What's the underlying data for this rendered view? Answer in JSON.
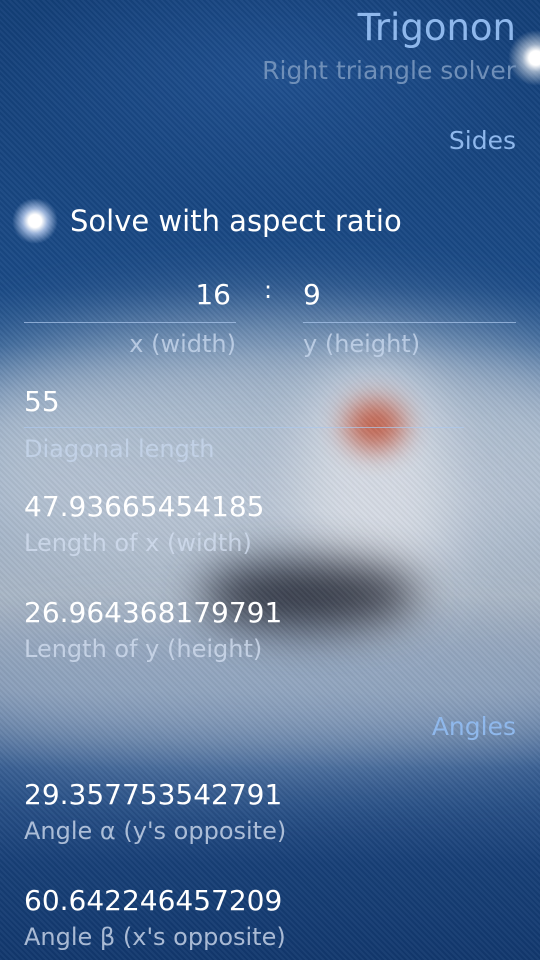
{
  "header": {
    "title": "Trigonon",
    "subtitle": "Right triangle solver"
  },
  "sections": {
    "sides": "Sides",
    "angles": "Angles"
  },
  "aspect_switch": {
    "label": "Solve with aspect ratio",
    "checked": true
  },
  "ratio": {
    "x_value": "16",
    "x_label": "x (width)",
    "separator": ":",
    "y_value": "9",
    "y_label": "y (height)"
  },
  "diagonal": {
    "value": "55",
    "label": "Diagonal length"
  },
  "length_x": {
    "value": "47.93665454185",
    "label": "Length of x (width)"
  },
  "length_y": {
    "value": "26.964368179791",
    "label": "Length of y (height)"
  },
  "angle_alpha": {
    "value": "29.357753542791",
    "label": "Angle α (y's opposite)"
  },
  "angle_beta": {
    "value": "60.642246457209",
    "label": "Angle β (x's opposite)"
  },
  "colors": {
    "accent": "#8fb8ec",
    "secondary": "#6f8fb8",
    "background": "#0f3a72"
  }
}
